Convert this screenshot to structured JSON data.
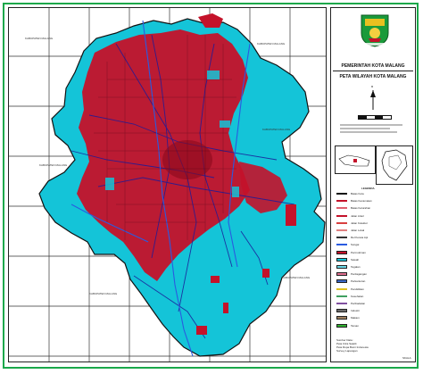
{
  "header": {
    "org": "PEMERINTAH KOTA MALANG",
    "map_title": "PETA WILAYAH KOTA MALANG"
  },
  "map": {
    "colors": {
      "city_fill": "#14c4d8",
      "built_up": "#c4122a",
      "roads": "#1b1b9a",
      "river": "#2a5be0",
      "grid": "#333333",
      "frame": "#1aa84a"
    },
    "neighbor_labels": [
      {
        "id": "nw",
        "text": "KABUPATEN MALANG"
      },
      {
        "id": "ne",
        "text": "KABUPATEN MALANG"
      },
      {
        "id": "w",
        "text": "KABUPATEN MALANG"
      },
      {
        "id": "e",
        "text": "KABUPATEN MALANG"
      },
      {
        "id": "sw",
        "text": "KABUPATEN MALANG"
      },
      {
        "id": "se",
        "text": "KABUPATEN MALANG"
      }
    ]
  },
  "legend": {
    "north_letter": "U",
    "title": "LEGENDA",
    "items": [
      {
        "label": "Batas Kota",
        "color": "#111111"
      },
      {
        "label": "Batas Kecamatan",
        "color": "#c4122a"
      },
      {
        "label": "Batas Kelurahan",
        "color": "#e06070"
      },
      {
        "label": "Jalan Arteri",
        "color": "#c4122a"
      },
      {
        "label": "Jalan Kolektor",
        "color": "#d84040"
      },
      {
        "label": "Jalan Lokal",
        "color": "#e08080"
      },
      {
        "label": "Rel Kereta Api",
        "color": "#333333"
      },
      {
        "label": "Sungai",
        "color": "#2a5be0"
      },
      {
        "label": "Permukiman",
        "color": "#c4122a"
      },
      {
        "label": "Sawah",
        "color": "#14c4d8"
      },
      {
        "label": "Tegalan",
        "color": "#6ad8e6"
      },
      {
        "label": "Perdagangan",
        "color": "#e07090"
      },
      {
        "label": "Perkantoran",
        "color": "#3a68c8"
      },
      {
        "label": "Pendidikan",
        "color": "#e0c020"
      },
      {
        "label": "Kesehatan",
        "color": "#40a060"
      },
      {
        "label": "Peribadatan",
        "color": "#8050a0"
      },
      {
        "label": "Industri",
        "color": "#6a6a6a"
      },
      {
        "label": "Makam",
        "color": "#a08060"
      },
      {
        "label": "Taman",
        "color": "#30b030"
      }
    ],
    "source_lines": [
      "Sumber Data :",
      "Peta Citra Satelit",
      "Peta Rupa Bumi Indonesia",
      "Survey Lapangan"
    ],
    "scale": "SKALA"
  }
}
